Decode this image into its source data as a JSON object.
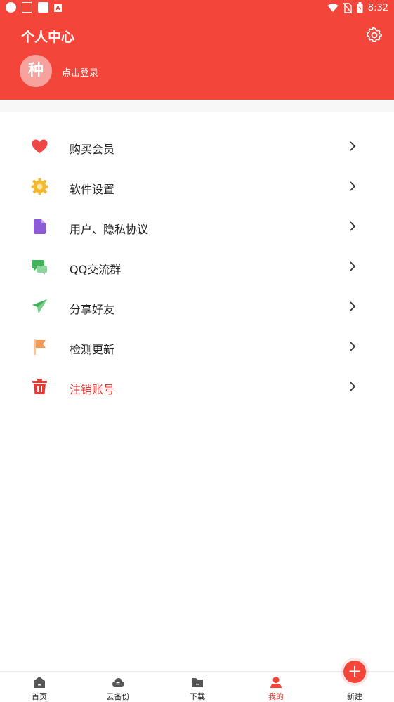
{
  "status_bar": {
    "time": "8:32",
    "icons": [
      "circle-icon",
      "app-icon",
      "square-icon",
      "a-icon",
      "wifi-icon",
      "no-sim-icon",
      "battery-icon"
    ]
  },
  "header": {
    "title": "个人中心",
    "avatar_text": "种",
    "login_text": "点击登录",
    "accent": "#f4453a"
  },
  "menu": [
    {
      "label": "购买会员",
      "icon": "heart-icon",
      "color": "#f04646"
    },
    {
      "label": "软件设置",
      "icon": "gear-icon",
      "color": "#f5b82e"
    },
    {
      "label": "用户、隐私协议",
      "icon": "document-icon",
      "color": "#8e5bd8"
    },
    {
      "label": "QQ交流群",
      "icon": "chat-icon",
      "color": "#43b35a"
    },
    {
      "label": "分享好友",
      "icon": "send-icon",
      "color": "#3cb15a"
    },
    {
      "label": "检测更新",
      "icon": "flag-icon",
      "color": "#f39a55"
    },
    {
      "label": "注销账号",
      "icon": "trash-icon",
      "color": "#e53935",
      "danger": true
    }
  ],
  "bottom_nav": [
    {
      "label": "首页",
      "icon": "home-icon"
    },
    {
      "label": "云备份",
      "icon": "cloud-icon"
    },
    {
      "label": "下载",
      "icon": "folder-icon"
    },
    {
      "label": "我的",
      "icon": "user-icon",
      "active": true
    },
    {
      "label": "新建",
      "icon": "plus-icon"
    }
  ],
  "fab": {
    "symbol": "+"
  }
}
